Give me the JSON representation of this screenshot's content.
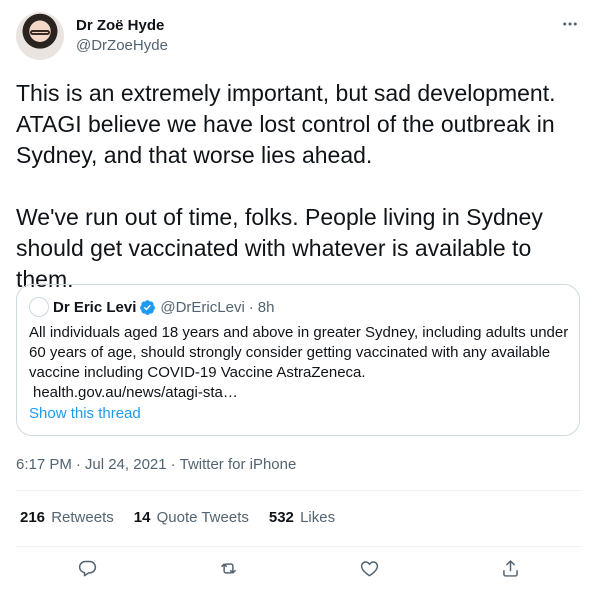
{
  "author": {
    "display_name": "Dr Zoë Hyde",
    "handle": "@DrZoeHyde"
  },
  "tweet": {
    "text": "This is an extremely important, but sad development. ATAGI believe we have lost control of the outbreak in Sydney, and that worse lies ahead.\n\nWe've run out of time, folks. People living in Sydney should get vaccinated with whatever is available to them.",
    "more_icon": "more-horizontal-icon"
  },
  "quoted_tweet": {
    "display_name": "Dr Eric Levi",
    "handle": "@DrEricLevi",
    "separator": "·",
    "time": "8h",
    "verified_icon": "verified-badge-icon",
    "text": "All individuals aged 18 years and above in greater Sydney, including adults under 60 years of age, should strongly consider getting vaccinated with any available vaccine including COVID-19 Vaccine AstraZeneca.",
    "link": "health.gov.au/news/atagi-sta…",
    "show_thread": "Show this thread"
  },
  "meta": {
    "time": "6:17 PM",
    "separator1": "·",
    "date": "Jul 24, 2021",
    "separator2": "·",
    "source": "Twitter for iPhone"
  },
  "stats": {
    "retweets_count": "216",
    "retweets_label": "Retweets",
    "quotes_count": "14",
    "quotes_label": "Quote Tweets",
    "likes_count": "532",
    "likes_label": "Likes"
  },
  "actions": [
    "reply-icon",
    "retweet-icon",
    "like-icon",
    "share-icon"
  ],
  "colors": {
    "text": "#0f1419",
    "secondary": "#536471",
    "link": "#1d9bf0",
    "border": "#cfd9de",
    "divider": "#eff3f4"
  }
}
